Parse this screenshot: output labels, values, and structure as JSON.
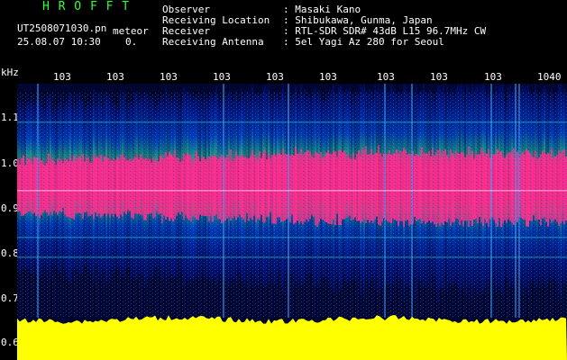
{
  "header": {
    "app_name": "H R O F F T",
    "filename": "UT2508071030.pn",
    "file_suffix": "meteor",
    "datetime": "25.08.07 10:30",
    "count": "0.",
    "observer_label": "Observer",
    "observer_value": ": Masaki Kano",
    "location_label": "Receiving Location",
    "location_value": ": Shibukawa, Gunma, Japan",
    "receiver_label": "Receiver",
    "receiver_value": ": RTL-SDR SDR# 43dB L15 96.7MHz CW",
    "antenna_label": "Receiving Antenna",
    "antenna_value": ": 5el Yagi Az 280 for Seoul"
  },
  "y_axis": {
    "unit": "kHz",
    "ticks": [
      "1.1",
      "1.0",
      "0.9",
      "0.8",
      "0.7",
      "0.6"
    ]
  },
  "x_axis": {
    "ticks": [
      "103",
      "103",
      "103",
      "103",
      "103",
      "103",
      "103",
      "103",
      "103",
      "1040"
    ]
  },
  "colors": {
    "background": "#000000",
    "text": "#ffffff",
    "title": "#33ff33",
    "signal_peak": "#ff2d8a",
    "noise_level": "#ffff00",
    "noise_floor": "#000a5a"
  }
}
